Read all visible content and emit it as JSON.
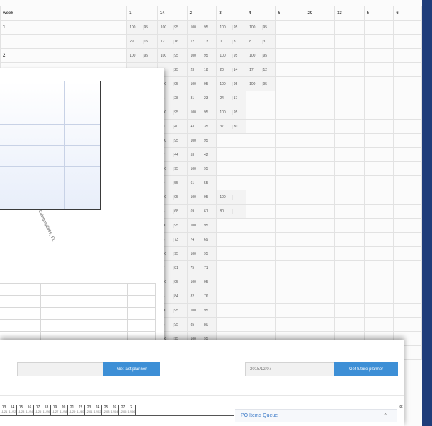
{
  "grid": {
    "header": [
      "week",
      "1",
      "14",
      "2",
      "3",
      "4",
      "5",
      "20",
      "13",
      "5",
      "6"
    ],
    "rows": [
      {
        "label": "1",
        "values": [
          [
            "100",
            "95",
            "100",
            "95",
            "100",
            "95",
            "100",
            "95",
            "100",
            "95"
          ],
          [
            "29",
            "15",
            "12",
            "16",
            "12",
            "13",
            "0",
            "3",
            "8",
            "3"
          ]
        ]
      },
      {
        "label": "2",
        "values": [
          [
            "100",
            "95",
            "100",
            "95",
            "100",
            "95",
            "100",
            "95",
            "100",
            "95"
          ],
          [
            "40",
            "24",
            "27",
            "25",
            "23",
            "18",
            "20",
            "14",
            "17",
            "12"
          ]
        ]
      },
      {
        "label": "",
        "values": [
          [
            "100",
            "95",
            "100",
            "95",
            "100",
            "95",
            "100",
            "95",
            "100",
            "95"
          ],
          [
            "31",
            "31",
            "35",
            "28",
            "31",
            "23",
            "24",
            "17"
          ]
        ]
      },
      {
        "label": "",
        "values": [
          [
            "100",
            "95",
            "100",
            "95",
            "100",
            "95",
            "100",
            "95"
          ],
          [
            "37",
            "41",
            "50",
            "40",
            "43",
            "35",
            "37",
            "30"
          ]
        ]
      },
      {
        "label": "",
        "values": [
          [
            "100",
            "95",
            "100",
            "95",
            "100",
            "95"
          ],
          [
            "99",
            "51",
            "57",
            "44",
            "53",
            "42"
          ]
        ]
      },
      {
        "label": "",
        "values": [
          [
            "100",
            "95",
            "100",
            "95",
            "100",
            "95"
          ],
          [
            "77",
            "66",
            "69",
            "55",
            "61",
            "55"
          ]
        ]
      },
      {
        "label": "",
        "values": [
          [
            "100",
            "95",
            "100",
            "95",
            "100",
            "95",
            "100"
          ],
          [
            "83",
            "75",
            "75",
            "68",
            "69",
            "61",
            "80"
          ]
        ]
      },
      {
        "label": "",
        "values": [
          [
            "100",
            "95",
            "100",
            "95",
            "100",
            "95"
          ],
          [
            "86",
            "80",
            "85",
            "73",
            "74",
            "69"
          ]
        ]
      },
      {
        "label": "",
        "values": [
          [
            "100",
            "95",
            "100",
            "95",
            "100",
            "95"
          ],
          [
            "85",
            "87",
            "87",
            "81",
            "75",
            "71"
          ]
        ]
      },
      {
        "label": "",
        "values": [
          [
            "100",
            "95",
            "100",
            "95",
            "100",
            "95"
          ],
          [
            "100",
            "94",
            "96",
            "84",
            "82",
            "76"
          ]
        ]
      },
      {
        "label": "",
        "values": [
          [
            "100",
            "95",
            "100",
            "95",
            "100",
            "95"
          ],
          [
            "107",
            "100",
            "95",
            "95",
            "85",
            "80"
          ]
        ]
      },
      {
        "label": "",
        "values": [
          [
            "100",
            "95",
            "100",
            "95",
            "100",
            "95"
          ],
          [
            "112",
            "109",
            "97",
            "97",
            "93",
            "88"
          ]
        ]
      }
    ]
  },
  "chart": {
    "rotated_label": "Category2006_PL"
  },
  "planner": {
    "last_button": "Get last planner",
    "future_date": "2015/12/07",
    "future_button": "Get future planner",
    "days": [
      {
        "n": "13",
        "s": "11/21"
      },
      {
        "n": "14",
        "s": "11/22"
      },
      {
        "n": "15",
        "s": "11/23"
      },
      {
        "n": "16",
        "s": "11/24"
      },
      {
        "n": "17",
        "s": "11/25"
      },
      {
        "n": "18",
        "s": "11/26"
      },
      {
        "n": "19",
        "s": "11/27"
      },
      {
        "n": "20",
        "s": "11/28"
      },
      {
        "n": "21",
        "s": "11/29"
      },
      {
        "n": "22",
        "s": "11/30"
      },
      {
        "n": "23",
        "s": "12/01"
      },
      {
        "n": "24",
        "s": "12/02"
      },
      {
        "n": "25",
        "s": "12/03"
      },
      {
        "n": "26",
        "s": "12/04"
      },
      {
        "n": "27",
        "s": "12/05"
      },
      {
        "n": "2",
        "s": "12/06"
      }
    ],
    "queue_title": "PO Items Queue",
    "queue_toggle": "^",
    "edge_label": "8t"
  }
}
